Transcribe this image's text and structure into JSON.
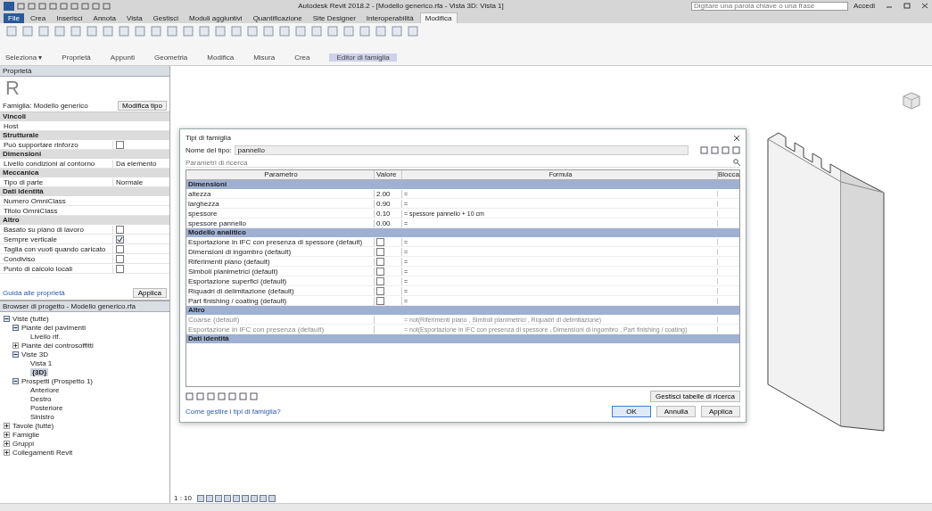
{
  "title_bar": {
    "title": "Autodesk Revit 2018.2 - [Modello generico.rfa - Vista 3D: Vista 1]",
    "search_placeholder": "Digitare una parola chiave o una frase",
    "user": "Accedi"
  },
  "ribbon_tabs": [
    {
      "label": "File",
      "selected": false,
      "kind": "file"
    },
    {
      "label": "Crea",
      "selected": false,
      "kind": "tab"
    },
    {
      "label": "Inserisci",
      "selected": false,
      "kind": "tab"
    },
    {
      "label": "Annota",
      "selected": false,
      "kind": "tab"
    },
    {
      "label": "Vista",
      "selected": false,
      "kind": "tab"
    },
    {
      "label": "Gestisci",
      "selected": false,
      "kind": "tab"
    },
    {
      "label": "Moduli aggiuntivi",
      "selected": false,
      "kind": "tab"
    },
    {
      "label": "Quantificazione",
      "selected": false,
      "kind": "tab"
    },
    {
      "label": "Site Designer",
      "selected": false,
      "kind": "tab"
    },
    {
      "label": "Interoperabilità",
      "selected": false,
      "kind": "tab"
    },
    {
      "label": "Modifica",
      "selected": true,
      "kind": "tab"
    }
  ],
  "ribbon_panels": [
    "Seleziona ▾",
    "Proprietà",
    "Appunti",
    "Geometria",
    "Modifica",
    "Misura",
    "Crea",
    "Editor di famiglia"
  ],
  "properties": {
    "title": "Proprietà",
    "logo": "R",
    "type_selector": "Famiglia: Modello generico",
    "edit_type": "Modifica tipo",
    "groups": [
      {
        "name": "Vincoli",
        "rows": [
          {
            "label": "Host",
            "kind": "text",
            "value": ""
          }
        ]
      },
      {
        "name": "Strutturale",
        "rows": [
          {
            "label": "Può supportare rinforzo",
            "kind": "checkbox",
            "checked": false
          }
        ]
      },
      {
        "name": "Dimensioni",
        "rows": [
          {
            "label": "Livello condizioni al contorno",
            "kind": "text",
            "value": "Da elemento"
          }
        ]
      },
      {
        "name": "Meccanica",
        "rows": [
          {
            "label": "Tipo di parte",
            "kind": "text",
            "value": "Normale"
          }
        ]
      },
      {
        "name": "Dati identità",
        "rows": [
          {
            "label": "Numero OmniClass",
            "kind": "text",
            "value": ""
          },
          {
            "label": "Titolo OmniClass",
            "kind": "text",
            "value": ""
          }
        ]
      },
      {
        "name": "Altro",
        "rows": [
          {
            "label": "Basato su piano di lavoro",
            "kind": "checkbox",
            "checked": false
          },
          {
            "label": "Sempre verticale",
            "kind": "checkbox",
            "checked": true
          },
          {
            "label": "Taglia con vuoti quando caricato",
            "kind": "checkbox",
            "checked": false
          },
          {
            "label": "Condiviso",
            "kind": "checkbox",
            "checked": false
          },
          {
            "label": "Punto di calcolo locali",
            "kind": "checkbox",
            "checked": false
          }
        ]
      }
    ],
    "help_link": "Guida alle proprietà",
    "apply": "Applica"
  },
  "project_browser": {
    "title": "Browser di progetto - Modello generico.rfa",
    "tree": [
      {
        "label": "Viste (tutte)",
        "expanded": true,
        "children": [
          {
            "label": "Piante dei pavimenti",
            "expanded": true,
            "children": [
              {
                "label": "Livello rif.",
                "selected": false
              }
            ]
          },
          {
            "label": "Piante dei controsoffitti",
            "expanded": false
          },
          {
            "label": "Viste 3D",
            "expanded": true,
            "children": [
              {
                "label": "Vista 1",
                "selected": false
              },
              {
                "label": "{3D}",
                "selected": true
              }
            ]
          },
          {
            "label": "Prospetti (Prospetto 1)",
            "expanded": true,
            "children": [
              {
                "label": "Anteriore",
                "selected": false
              },
              {
                "label": "Destro",
                "selected": false
              },
              {
                "label": "Posteriore",
                "selected": false
              },
              {
                "label": "Sinistro",
                "selected": false
              }
            ]
          }
        ]
      },
      {
        "label": "Tavole (tutte)",
        "expanded": false
      },
      {
        "label": "Famiglie",
        "expanded": false
      },
      {
        "label": "Gruppi",
        "expanded": false
      },
      {
        "label": "Collegamenti Revit",
        "expanded": false
      }
    ]
  },
  "dialog": {
    "title": "Tipi di famiglia",
    "type_name_label": "Nome del tipo:",
    "type_name": "pannello",
    "search_placeholder": "Parametri di ricerca",
    "columns": [
      "Parametro",
      "Valore",
      "Formula",
      "Blocca"
    ],
    "groups": [
      {
        "name": "Dimensioni",
        "rows": [
          {
            "name": "altezza",
            "kind": "value",
            "value": "2.00",
            "formula": "=",
            "greyed": false
          },
          {
            "name": "larghezza",
            "kind": "value",
            "value": "0.90",
            "formula": "=",
            "greyed": false
          },
          {
            "name": "spessore",
            "kind": "value",
            "value": "0.10",
            "formula": "= spessore pannello + 10 cm",
            "greyed": false
          },
          {
            "name": "spessore pannello",
            "kind": "value",
            "value": "0.00",
            "formula": "=",
            "greyed": false
          }
        ]
      },
      {
        "name": "Modello analitico",
        "rows": [
          {
            "name": "Esportazione in IFC con presenza di spessore (default)",
            "kind": "checkbox",
            "checked": false,
            "formula": "=",
            "greyed": false
          },
          {
            "name": "Dimensioni di ingombro (default)",
            "kind": "checkbox",
            "checked": false,
            "formula": "=",
            "greyed": false
          },
          {
            "name": "Riferimenti piano (default)",
            "kind": "checkbox",
            "checked": false,
            "formula": "=",
            "greyed": false
          },
          {
            "name": "Simboli planimetrici (default)",
            "kind": "checkbox",
            "checked": false,
            "formula": "=",
            "greyed": false
          },
          {
            "name": "Esportazione superfici (default)",
            "kind": "checkbox",
            "checked": false,
            "formula": "=",
            "greyed": false
          },
          {
            "name": "Riquadri di delimitazione (default)",
            "kind": "checkbox",
            "checked": false,
            "formula": "=",
            "greyed": false
          },
          {
            "name": "Part finishing / coating (default)",
            "kind": "checkbox",
            "checked": false,
            "formula": "=",
            "greyed": false
          }
        ]
      },
      {
        "name": "Altro",
        "rows": [
          {
            "name": "Coarse (default)",
            "kind": "value",
            "value": "",
            "formula": "= not(Riferimenti piano , Simboli planimetrici , Riquadri di delimitazione)",
            "greyed": true
          },
          {
            "name": "Esportazione in IFC con presenza (default)",
            "kind": "value",
            "value": "",
            "formula": "= not(Esportazione in IFC con presenza di spessore , Dimensioni di ingombro , Part finishing / coating)",
            "greyed": true
          }
        ]
      },
      {
        "name": "Dati identità"
      }
    ],
    "manage_lookup": "Gestisci tabelle di ricerca",
    "help_link": "Come gestire i tipi di famiglia?",
    "buttons": [
      {
        "label": "OK",
        "kind": "default"
      },
      {
        "label": "Annulla",
        "kind": "normal"
      },
      {
        "label": "Applica",
        "kind": "normal"
      }
    ]
  },
  "view_bar": {
    "scale": "1 : 10"
  }
}
